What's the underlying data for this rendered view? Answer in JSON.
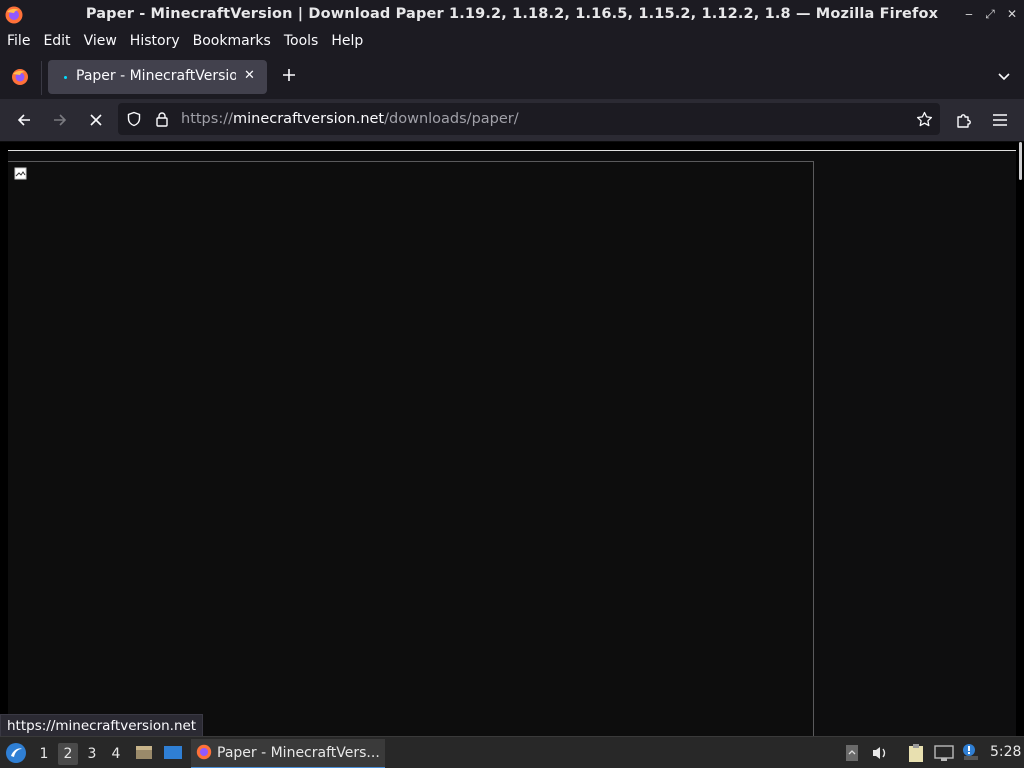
{
  "window": {
    "title": "Paper - MinecraftVersion | Download Paper 1.19.2, 1.18.2, 1.16.5, 1.15.2, 1.12.2, 1.8 — Mozilla Firefox"
  },
  "menu": [
    "File",
    "Edit",
    "View",
    "History",
    "Bookmarks",
    "Tools",
    "Help"
  ],
  "tabs": [
    {
      "label": "Paper - MinecraftVersion",
      "active": true
    }
  ],
  "urlbar": {
    "prefix": "https://",
    "domain": "minecraftversion.net",
    "path": "/downloads/paper/"
  },
  "status_text": "https://minecraftversion.net",
  "taskbar": {
    "workspaces": [
      "1",
      "2",
      "3",
      "4"
    ],
    "active_workspace": "2",
    "task_label": "Paper - MinecraftVers...",
    "clock": "5:28"
  },
  "colors": {
    "accent": "#4a8fd8",
    "tab_dot": "#00ddff",
    "firefox_orange": "#ff7139"
  },
  "icons": {
    "app": "firefox-icon",
    "back": "arrow-left-icon",
    "forward": "arrow-right-icon",
    "stop": "close-icon",
    "shield": "shield-icon",
    "lock": "lock-icon",
    "bookmark": "star-icon",
    "extensions": "puzzle-icon",
    "menu": "hamburger-icon",
    "new_tab": "plus-icon",
    "tab_list": "chevron-down-icon",
    "broken_image": "broken-image-icon"
  }
}
